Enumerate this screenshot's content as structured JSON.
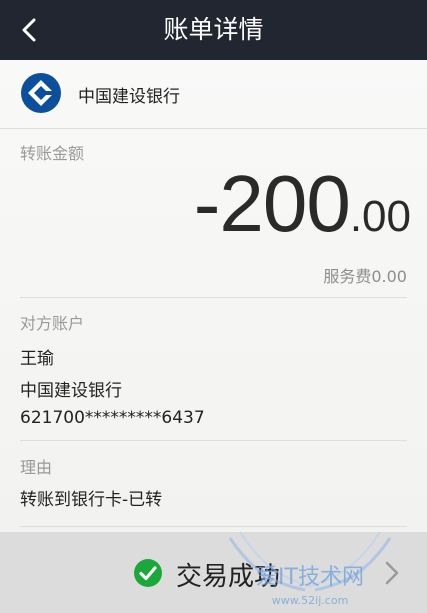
{
  "header": {
    "title": "账单详情",
    "back_icon": "chevron-left-icon"
  },
  "bank": {
    "name": "中国建设银行",
    "logo_color": "#0c4f9c"
  },
  "transfer": {
    "amount_label": "转账金额",
    "amount_integer": "-200",
    "amount_decimal": ".00",
    "fee_text": "服务费0.00"
  },
  "counterparty": {
    "label": "对方账户",
    "name": "王瑜",
    "bank": "中国建设银行",
    "account": "621700*********6437"
  },
  "reason": {
    "label": "理由",
    "value": "转账到银行卡-已转"
  },
  "footer": {
    "status": "交易成功",
    "status_color": "#1aa83a"
  },
  "watermark": {
    "text": "爱IT技术网",
    "url": "www.52ij.com"
  }
}
